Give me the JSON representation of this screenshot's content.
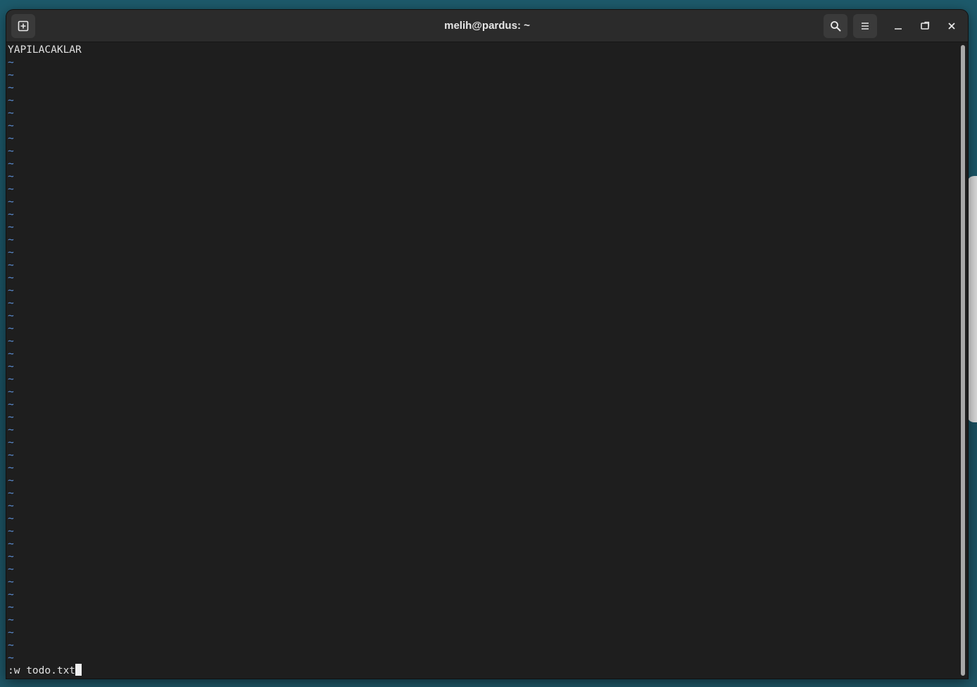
{
  "window": {
    "title": "melih@pardus: ~"
  },
  "icons": {
    "new_tab": "new-tab-icon",
    "search": "search-icon",
    "menu": "hamburger-menu-icon",
    "minimize": "minimize-icon",
    "maximize": "maximize-icon",
    "close": "close-icon"
  },
  "editor": {
    "first_line": "YAPILACAKLAR",
    "empty_line_marker": "~",
    "empty_line_count": 48,
    "command_line": ":w todo.txt"
  },
  "colors": {
    "tilde": "#5c8fd6",
    "background": "#1e1e1e",
    "headerbar": "#2b2b2b"
  }
}
